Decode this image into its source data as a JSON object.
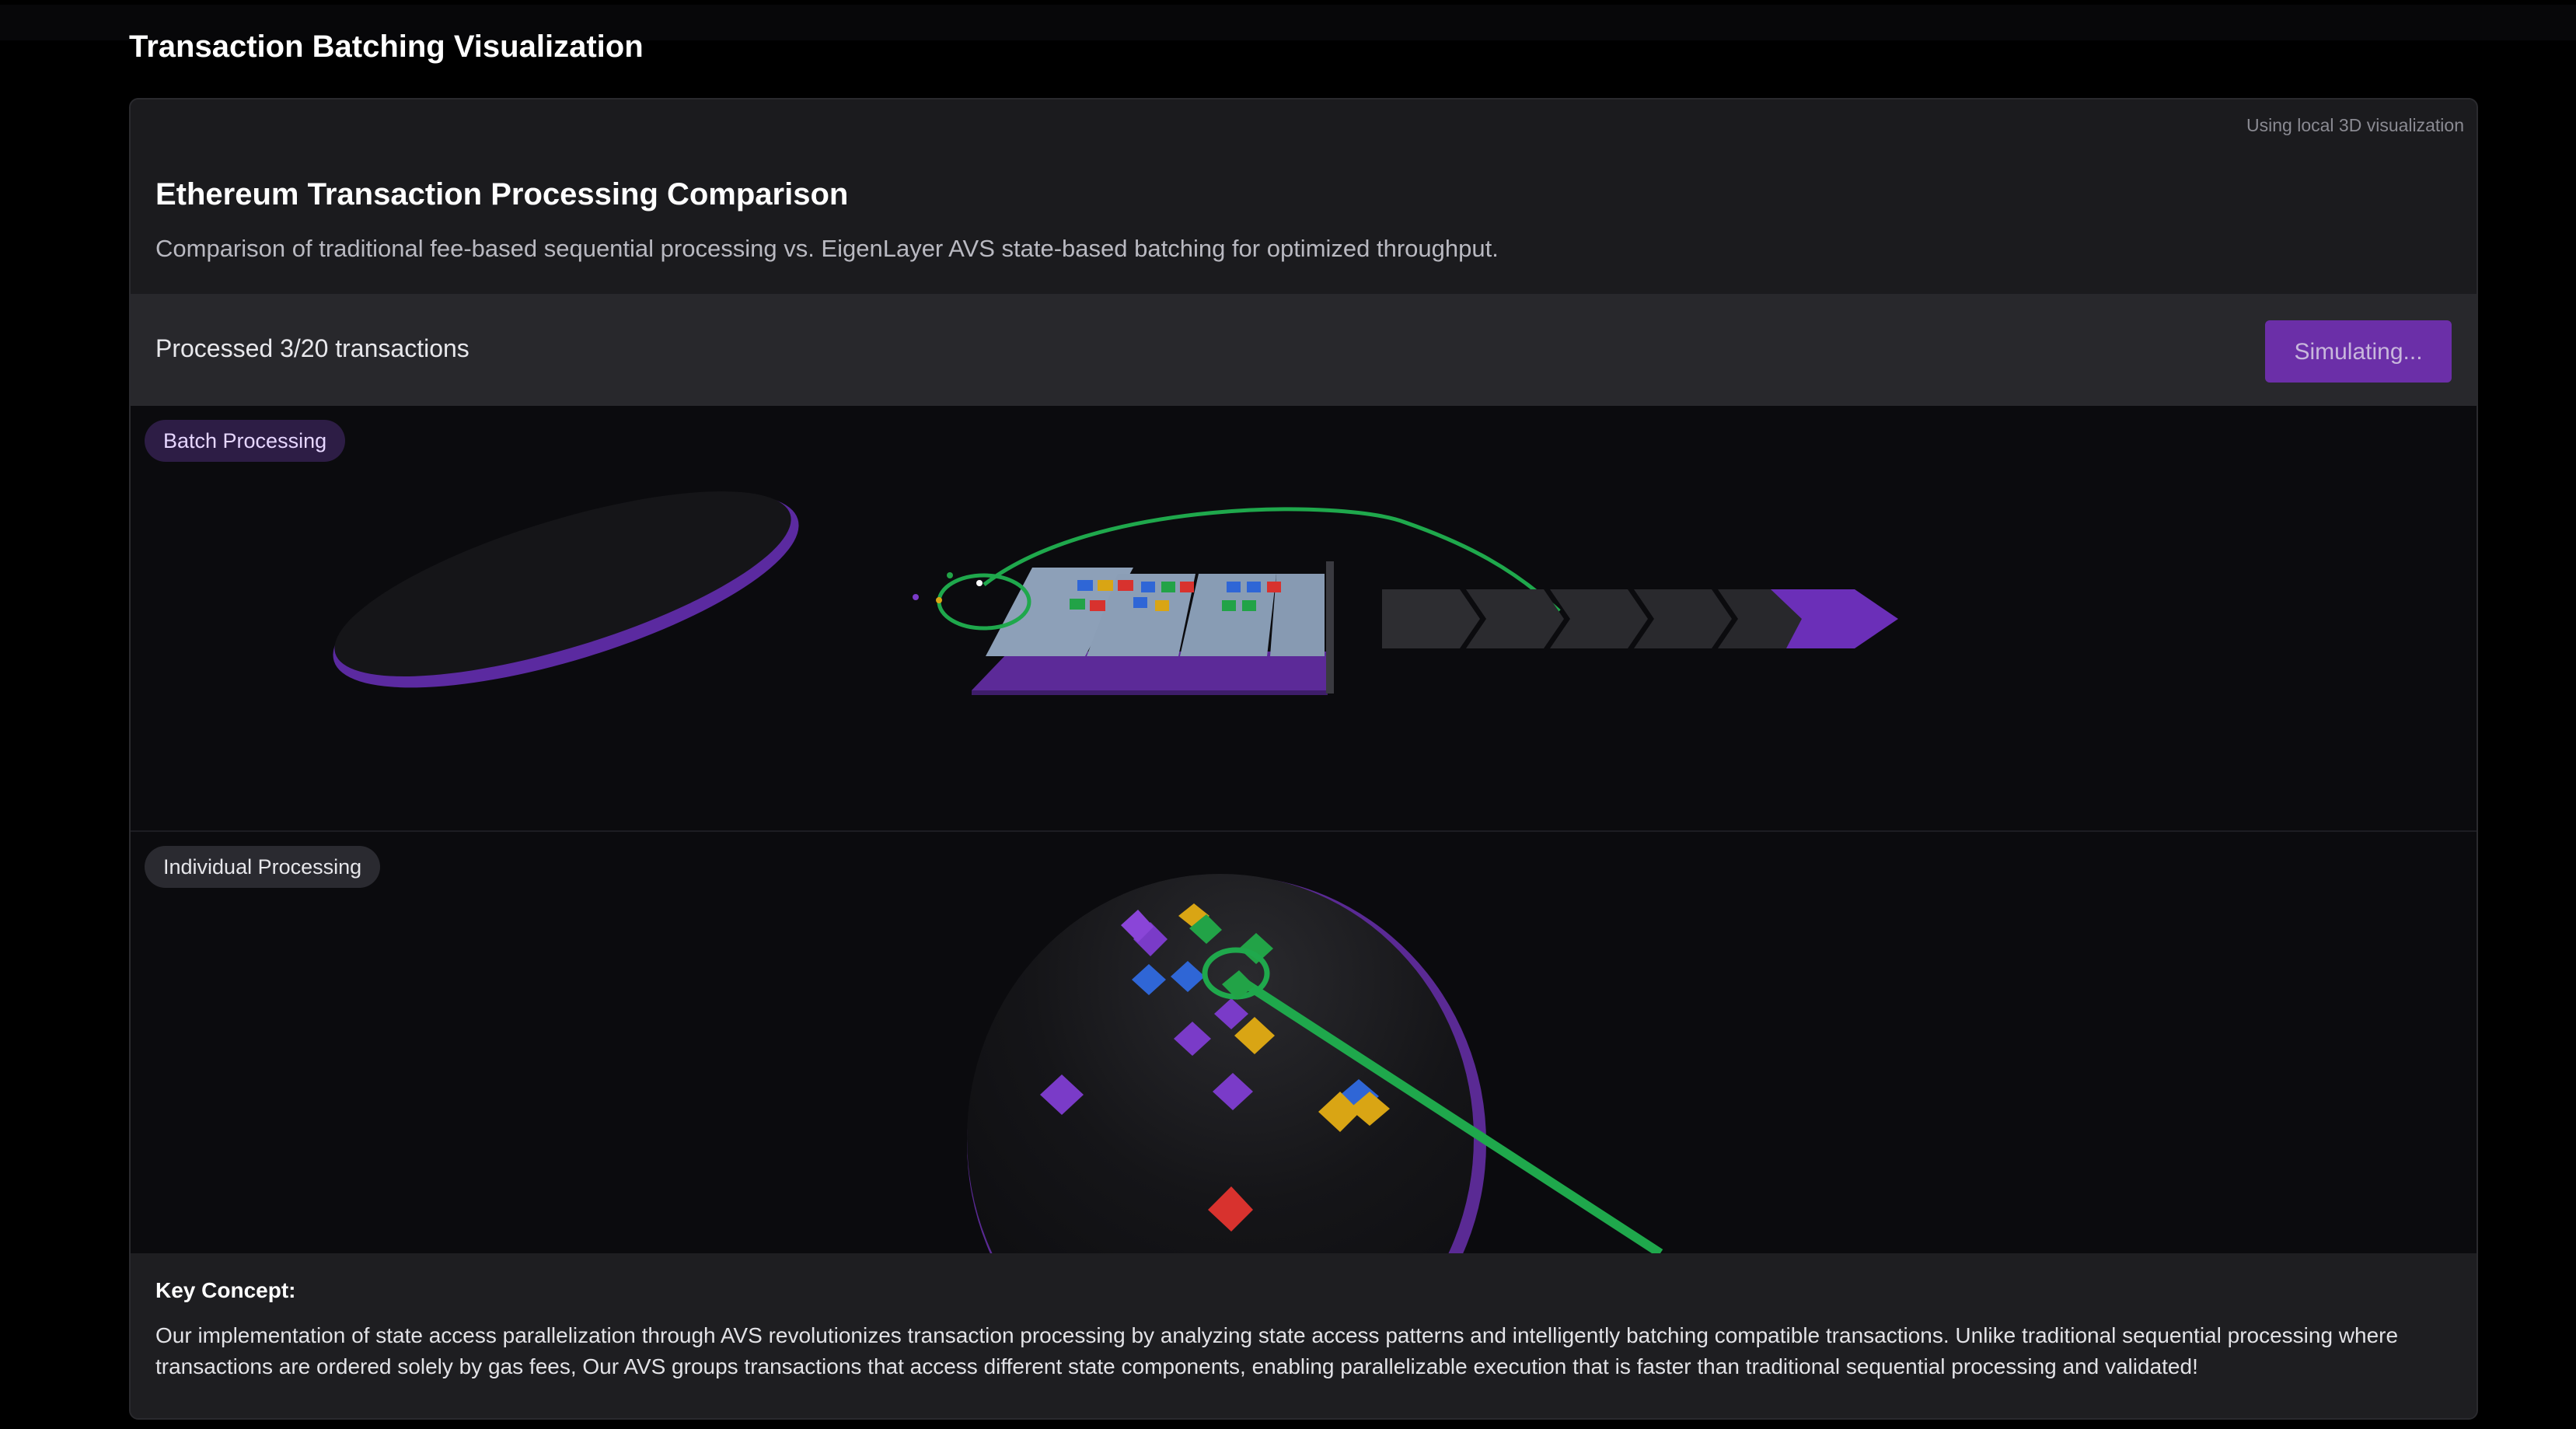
{
  "page": {
    "title": "Transaction Batching Visualization"
  },
  "card": {
    "viz_note": "Using local 3D visualization",
    "title": "Ethereum Transaction Processing Comparison",
    "description": "Comparison of traditional fee-based sequential processing vs. EigenLayer AVS state-based batching for optimized throughput."
  },
  "controls": {
    "progress_text": "Processed 3/20 transactions",
    "simulate_button": "Simulating..."
  },
  "scenes": {
    "batch": {
      "label": "Batch Processing"
    },
    "individual": {
      "label": "Individual Processing"
    }
  },
  "key_concept": {
    "title": "Key Concept:",
    "text": "Our implementation of state access parallelization through AVS revolutionizes transaction processing by analyzing state access patterns and intelligently batching compatible transactions. Unlike traditional sequential processing where transactions are ordered solely by gas fees, Our AVS groups transactions that access different state components, enabling parallelizable execution that is faster than traditional sequential processing and validated!"
  },
  "colors": {
    "accent_purple": "#6b2fa8",
    "path_green": "#1fa84c",
    "tx_blue": "#2f66d6",
    "tx_red": "#d8322e",
    "tx_yellow": "#d9a514",
    "tx_green": "#22a347",
    "tx_purple": "#7a3bc8"
  }
}
